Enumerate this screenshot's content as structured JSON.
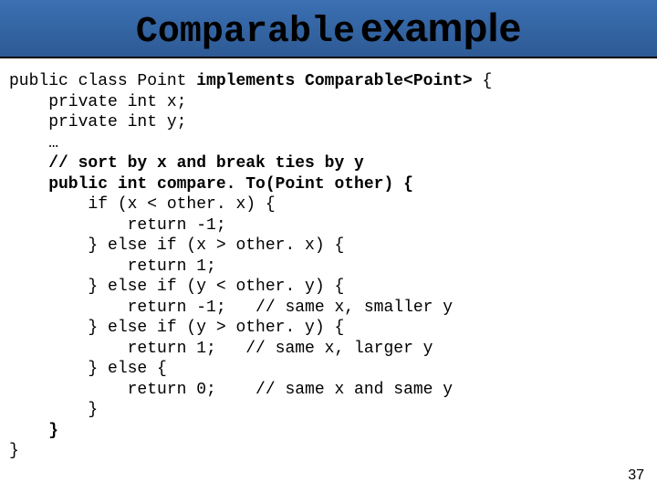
{
  "title": {
    "word1": "Comparable",
    "word2": "example"
  },
  "code": {
    "l01a": "public class Point",
    "l01b": " implements Comparable<Point>",
    "l01c": " {",
    "l02": "    private int x;",
    "l03": "    private int y;",
    "l04": "    …",
    "l05": "    // sort by x and break ties by y",
    "l06": "    public int compare. To(Point other) {",
    "l07": "        if (x < other. x) {",
    "l08": "            return -1;",
    "l09": "        } else if (x > other. x) {",
    "l10": "            return 1;",
    "l11": "        } else if (y < other. y) {",
    "l12": "            return -1;   // same x, smaller y",
    "l13": "        } else if (y > other. y) {",
    "l14": "            return 1;   // same x, larger y",
    "l15": "        } else {",
    "l16": "            return 0;    // same x and same y",
    "l17": "        }",
    "l18": "    }",
    "l19": "}"
  },
  "page_number": "37"
}
